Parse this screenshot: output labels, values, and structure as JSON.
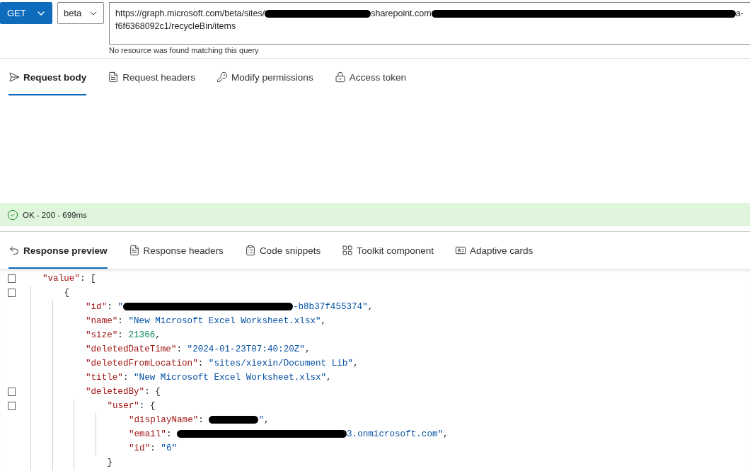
{
  "request_bar": {
    "method": "GET",
    "version": "beta",
    "url_parts": [
      {
        "kind": "text",
        "text": "https://graph.microsoft.com/beta/sites/"
      },
      {
        "kind": "redact-medium"
      },
      {
        "kind": "text",
        "text": "sharepoint.com"
      },
      {
        "kind": "redact-long"
      },
      {
        "kind": "text",
        "text": "a-"
      },
      {
        "kind": "break"
      },
      {
        "kind": "text",
        "text": "f6f6368092c1/recycleBin/items"
      }
    ],
    "hint": "No resource was found matching this query"
  },
  "request_tabs": [
    {
      "label": "Request body",
      "selected": true
    },
    {
      "label": "Request headers",
      "selected": false
    },
    {
      "label": "Modify permissions",
      "selected": false
    },
    {
      "label": "Access token",
      "selected": false
    }
  ],
  "status": {
    "text": "OK - 200 - 699ms"
  },
  "response_tabs": [
    {
      "label": "Response preview",
      "selected": true
    },
    {
      "label": "Response headers",
      "selected": false
    },
    {
      "label": "Code snippets",
      "selected": false
    },
    {
      "label": "Toolkit component",
      "selected": false
    },
    {
      "label": "Adaptive cards",
      "selected": false
    }
  ],
  "code": [
    {
      "foldable": true,
      "tokens": [
        {
          "kind": "key",
          "text": "\"value\""
        },
        {
          "kind": "punct",
          "text": ": ["
        }
      ],
      "children": [
        {
          "foldable": true,
          "tokens": [
            {
              "kind": "punct",
              "text": "{"
            }
          ],
          "children": [
            {
              "foldable": false,
              "tokens": [
                {
                  "kind": "key",
                  "text": "\"id\""
                },
                {
                  "kind": "punct",
                  "text": ": "
                },
                {
                  "kind": "string",
                  "text": "\""
                },
                {
                  "kind": "redact-long"
                },
                {
                  "kind": "string",
                  "text": "-b8b37f455374\""
                },
                {
                  "kind": "punct",
                  "text": ","
                }
              ]
            },
            {
              "foldable": false,
              "tokens": [
                {
                  "kind": "key",
                  "text": "\"name\""
                },
                {
                  "kind": "punct",
                  "text": ": "
                },
                {
                  "kind": "string",
                  "text": "\"New Microsoft Excel Worksheet.xlsx\""
                },
                {
                  "kind": "punct",
                  "text": ","
                }
              ]
            },
            {
              "foldable": false,
              "tokens": [
                {
                  "kind": "key",
                  "text": "\"size\""
                },
                {
                  "kind": "punct",
                  "text": ": "
                },
                {
                  "kind": "number",
                  "text": "21366"
                },
                {
                  "kind": "punct",
                  "text": ","
                }
              ]
            },
            {
              "foldable": false,
              "tokens": [
                {
                  "kind": "key",
                  "text": "\"deletedDateTime\""
                },
                {
                  "kind": "punct",
                  "text": ": "
                },
                {
                  "kind": "string",
                  "text": "\"2024-01-23T07:40:20Z\""
                },
                {
                  "kind": "punct",
                  "text": ","
                }
              ]
            },
            {
              "foldable": false,
              "tokens": [
                {
                  "kind": "key",
                  "text": "\"deletedFromLocation\""
                },
                {
                  "kind": "punct",
                  "text": ": "
                },
                {
                  "kind": "string",
                  "text": "\"sites/xiexin/Document Lib\""
                },
                {
                  "kind": "punct",
                  "text": ","
                }
              ]
            },
            {
              "foldable": false,
              "tokens": [
                {
                  "kind": "key",
                  "text": "\"title\""
                },
                {
                  "kind": "punct",
                  "text": ": "
                },
                {
                  "kind": "string",
                  "text": "\"New Microsoft Excel Worksheet.xlsx\""
                },
                {
                  "kind": "punct",
                  "text": ","
                }
              ]
            },
            {
              "foldable": true,
              "tokens": [
                {
                  "kind": "key",
                  "text": "\"deletedBy\""
                },
                {
                  "kind": "punct",
                  "text": ": {"
                }
              ],
              "children": [
                {
                  "foldable": true,
                  "tokens": [
                    {
                      "kind": "key",
                      "text": "\"user\""
                    },
                    {
                      "kind": "punct",
                      "text": ": {"
                    }
                  ],
                  "children": [
                    {
                      "foldable": false,
                      "tokens": [
                        {
                          "kind": "key",
                          "text": "\"displayName\""
                        },
                        {
                          "kind": "punct",
                          "text": ": "
                        },
                        {
                          "kind": "redact-short"
                        },
                        {
                          "kind": "string",
                          "text": "\""
                        },
                        {
                          "kind": "punct",
                          "text": ","
                        }
                      ]
                    },
                    {
                      "foldable": false,
                      "tokens": [
                        {
                          "kind": "key",
                          "text": "\"email\""
                        },
                        {
                          "kind": "punct",
                          "text": ": "
                        },
                        {
                          "kind": "redact-long"
                        },
                        {
                          "kind": "string",
                          "text": "3.onmicrosoft.com\""
                        },
                        {
                          "kind": "punct",
                          "text": ","
                        }
                      ]
                    },
                    {
                      "foldable": false,
                      "tokens": [
                        {
                          "kind": "key",
                          "text": "\"id\""
                        },
                        {
                          "kind": "punct",
                          "text": ": "
                        },
                        {
                          "kind": "string",
                          "text": "\"6\""
                        }
                      ]
                    }
                  ]
                },
                {
                  "foldable": false,
                  "tokens": [
                    {
                      "kind": "punct",
                      "text": "}"
                    }
                  ]
                }
              ]
            }
          ]
        }
      ]
    }
  ]
}
